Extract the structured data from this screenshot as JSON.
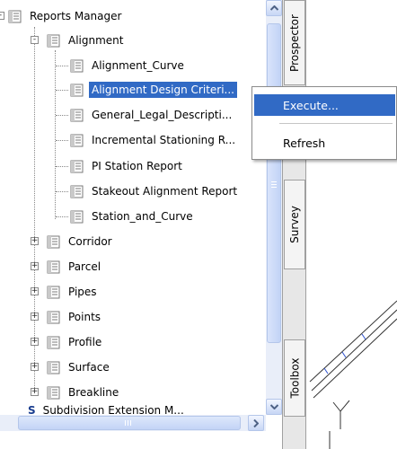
{
  "tree": {
    "root": {
      "label": "Reports Manager",
      "expander": "-"
    },
    "alignment": {
      "label": "Alignment",
      "expander": "-",
      "children": [
        "Alignment_Curve",
        "Alignment Design Criteri...",
        "General_Legal_Descripti...",
        "Incremental Stationing R...",
        "PI Station Report",
        "Stakeout Alignment Report",
        "Station_and_Curve"
      ],
      "selected_index": 1
    },
    "categories": [
      "Corridor",
      "Parcel",
      "Pipes",
      "Points",
      "Profile",
      "Surface",
      "Breakline"
    ],
    "category_expander": "+",
    "partial_last": "Subdivision Extension M..."
  },
  "tabs": {
    "prospector": "Prospector",
    "survey": "Survey",
    "toolbox": "Toolbox"
  },
  "context_menu": {
    "items": [
      "Execute...",
      "Refresh"
    ],
    "highlighted": "Execute..."
  },
  "colors": {
    "selection": "#316ac5",
    "scrollbar": "#c2d3f6"
  }
}
